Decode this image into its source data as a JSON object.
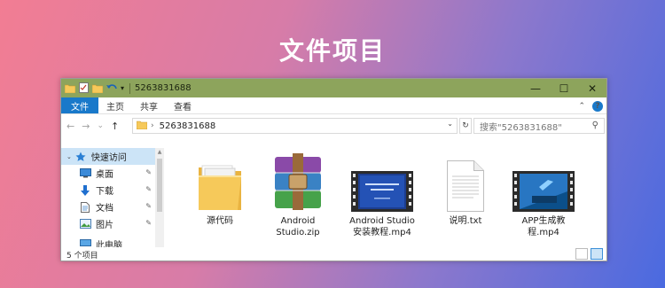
{
  "banner": {
    "title": "文件项目"
  },
  "window": {
    "title": "5263831688",
    "quick_access_toolbar": [
      "folder-icon",
      "properties-check-icon",
      "new-folder-icon",
      "undo-icon",
      "customize-dropdown-icon"
    ],
    "controls": {
      "minimize": "—",
      "maximize": "☐",
      "close": "✕"
    }
  },
  "ribbon": {
    "tabs": [
      "文件",
      "主页",
      "共享",
      "查看"
    ],
    "active_tab": "文件",
    "collapse_glyph": "⌃",
    "help_glyph": "?"
  },
  "nav": {
    "back_glyph": "←",
    "forward_glyph": "→",
    "recent_glyph": "⌄",
    "up_glyph": "↑",
    "address_path": "5263831688",
    "address_dropdown_glyph": "⌄",
    "refresh_glyph": "↻",
    "search_placeholder": "搜索\"5263831688\"",
    "search_icon_glyph": "⚲"
  },
  "sidebar": {
    "items": [
      {
        "label": "快速访问",
        "icon": "star-icon",
        "pinned": false
      },
      {
        "label": "桌面",
        "icon": "desktop-icon",
        "pinned": true
      },
      {
        "label": "下载",
        "icon": "download-arrow-icon",
        "pinned": true
      },
      {
        "label": "文档",
        "icon": "document-icon",
        "pinned": true
      },
      {
        "label": "图片",
        "icon": "pictures-icon",
        "pinned": true
      },
      {
        "label": "此电脑",
        "icon": "computer-icon",
        "pinned": false
      }
    ],
    "pin_glyph": "✎"
  },
  "files": [
    {
      "name": "源代码",
      "type": "folder"
    },
    {
      "name": "Android Studio.zip",
      "type": "winrar-archive"
    },
    {
      "name": "Android Studio 安装教程.mp4",
      "type": "video"
    },
    {
      "name": "说明.txt",
      "type": "text-file"
    },
    {
      "name": "APP生成教程.mp4",
      "type": "video"
    }
  ],
  "status": {
    "count_text": "5 个项目"
  },
  "colors": {
    "titlebar": "#8da45c",
    "ribbon_active": "#1979ca",
    "selection": "#cce4f7",
    "folder": "#f6c95a"
  }
}
